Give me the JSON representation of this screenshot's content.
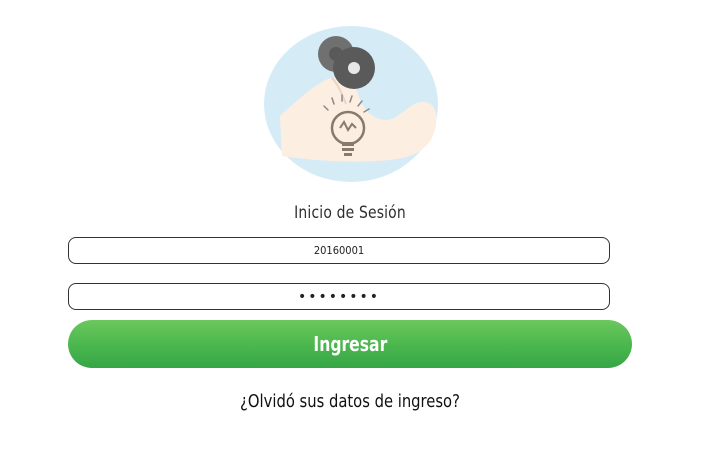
{
  "login": {
    "title": "Inicio de Sesión",
    "username_value": "20160001",
    "password_value": "••••••••",
    "submit_label": "Ingresar",
    "forgot_link": "¿Olvidó sus datos de ingreso?"
  },
  "logo": {
    "icon": "strong-arm-dumbbell-lightbulb-icon"
  },
  "colors": {
    "button_top": "#6cc75e",
    "button_bottom": "#35a646",
    "logo_circle": "#d5ecf7",
    "arm": "#fdeee2"
  }
}
